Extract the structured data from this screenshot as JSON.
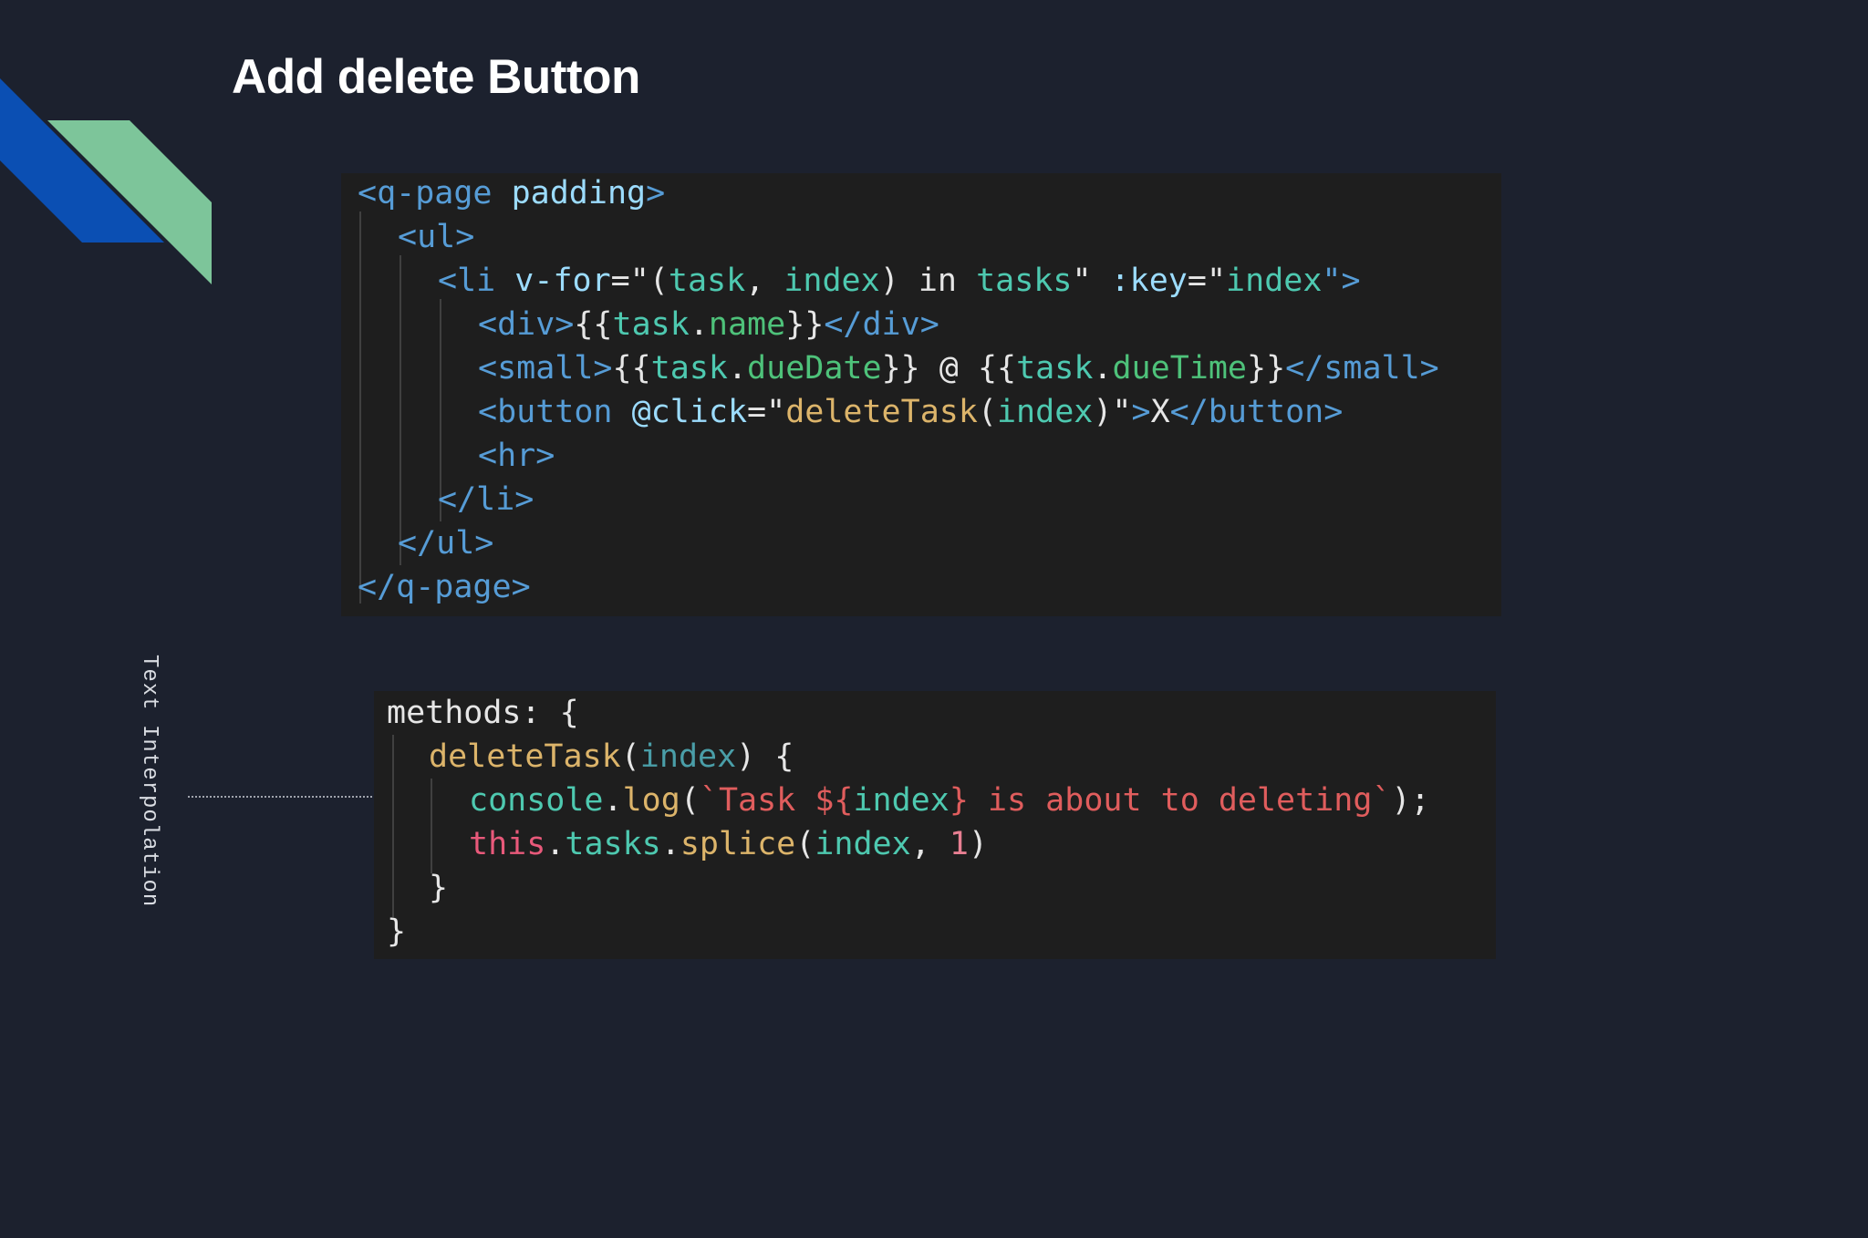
{
  "slide": {
    "title": "Add delete Button",
    "side_label": "Text Interpolation",
    "accent_colors": {
      "blue": "#0b4fb3",
      "green": "#7dc59a",
      "background": "#1c212e",
      "code_background": "#1e1e1e"
    }
  },
  "template_code": {
    "line1": {
      "open": "<q-page",
      "attr": "padding",
      "close": ">"
    },
    "line2": {
      "tag": "<ul>"
    },
    "line3": {
      "open": "<li",
      "attr1": "v-for",
      "eq1": "=\"(",
      "var1": "task",
      "comma": ",",
      "var2": "index",
      "paren": ")",
      "kw_in": "in",
      "var3": "tasks",
      "q1": "\"",
      "attr2": ":key",
      "eq2": "=\"",
      "var4": "index",
      "end": "\">"
    },
    "line4": {
      "open": "<div>",
      "mustache_open": "{{",
      "obj": "task",
      "dot": ".",
      "prop": "name",
      "mustache_close": "}}",
      "close": "</div>"
    },
    "line5": {
      "open": "<small>",
      "m1_open": "{{",
      "obj1": "task",
      "dot1": ".",
      "prop1": "dueDate",
      "m1_close": "}}",
      "at": "@",
      "m2_open": "{{",
      "obj2": "task",
      "dot2": ".",
      "prop2": "dueTime",
      "m2_close": "}}",
      "close": "</small>"
    },
    "line6": {
      "open": "<button",
      "attr": "@click",
      "eq": "=\"",
      "fn": "deleteTask",
      "lparen": "(",
      "arg": "index",
      "rparen": ")",
      "q": "\"",
      "gt": ">",
      "text": "X",
      "close": "</button>"
    },
    "line7": {
      "tag": "<hr>"
    },
    "line8": {
      "tag": "</li>"
    },
    "line9": {
      "tag": "</ul>"
    },
    "line10": {
      "tag": "</q-page>"
    }
  },
  "methods_code": {
    "line1": {
      "text": "methods: {"
    },
    "line2": {
      "fn": "deleteTask",
      "lparen": "(",
      "param": "index",
      "rest": ") {"
    },
    "line3": {
      "obj": "console",
      "dot": ".",
      "fn": "log",
      "lparen": "(",
      "str1": "`Task ${",
      "var": "index",
      "str2": "} is about to deleting`",
      "end": ");"
    },
    "line4": {
      "kw": "this",
      "dot1": ".",
      "prop": "tasks",
      "dot2": ".",
      "fn": "splice",
      "lparen": "(",
      "arg": "index",
      "comma": ",",
      "num": "1",
      "rparen": ")"
    },
    "line5": {
      "text": "}"
    },
    "line6": {
      "text": "}"
    }
  }
}
